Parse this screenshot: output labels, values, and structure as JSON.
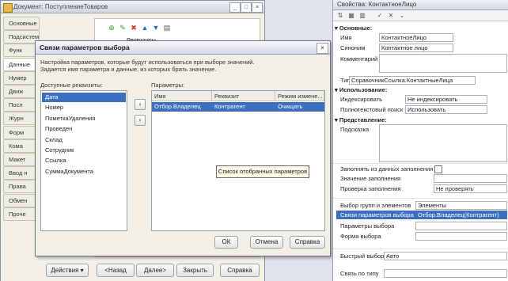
{
  "doc_window": {
    "title": "Документ: ПоступлениеТоваров",
    "tabs": [
      "Основные",
      "Подсистемы",
      "Функ",
      "Данные",
      "Нумер",
      "Движ",
      "Посл",
      "Журн",
      "Форм",
      "Кома",
      "Макет",
      "Ввод н",
      "Права",
      "Обмен",
      "Проче"
    ],
    "panel_item": "Реквизиты",
    "bottom_buttons": {
      "actions": "Действия",
      "back": "<Назад",
      "next": "Далее>",
      "close": "Закрыть",
      "help": "Справка"
    }
  },
  "dialog": {
    "title": "Связи параметров выбора",
    "description_line1": "Настройка параметров, которые будут использоваться при выборе значений.",
    "description_line2": "Задается имя параметра и данные, из которых брать значение.",
    "available_label": "Доступные реквизиты:",
    "params_label": "Параметры:",
    "available_items": [
      "Дата",
      "Номер",
      "ПометкаУдаления",
      "Проведен",
      "Склад",
      "Сотрудник",
      "Ссылка",
      "СуммаДокумента"
    ],
    "columns": {
      "name": "Имя",
      "attribute": "Реквизит",
      "mode": "Режим измене..."
    },
    "row": {
      "name": "Отбор.Владелец",
      "attribute": "Контрагент",
      "mode": "Очищать"
    },
    "tooltip": "Список отобранных параметров",
    "buttons": {
      "ok": "ОК",
      "cancel": "Отмена",
      "help": "Справка"
    }
  },
  "props": {
    "title": "Свойства: КонтактноеЛицо",
    "sections": {
      "main": "Основные:",
      "usage": "Использование:",
      "view": "Представление:"
    },
    "name_label": "Имя",
    "name_value": "КонтактноеЛицо",
    "synonym_label": "Синоним",
    "synonym_value": "Контактное лицо",
    "comment_label": "Комментарий",
    "type_label": "Тип",
    "type_value": "СправочникСсылка.КонтактныеЛица",
    "index_label": "Индексировать",
    "index_value": "Не индексировать",
    "fts_label": "Полнотекстовый поиск",
    "fts_value": "Использовать",
    "hint_label": "Подсказка",
    "fill_from_label": "Заполнять из данных заполнения",
    "fill_value_label": "Значение заполнения",
    "check_fill_label": "Проверка заполнения",
    "check_fill_value": "Не проверять",
    "group_select_label": "Выбор групп и элементов",
    "group_select_value": "Элементы",
    "links_label": "Связи параметров выбора",
    "links_value": "Отбор.Владелец(Контрагент)",
    "params_label": "Параметры выбора",
    "form_label": "Форма выбора",
    "quick_label": "Быстрый выбор",
    "quick_value": "Авто",
    "link_type_label": "Связь по типу"
  },
  "colors": {
    "selection": "#3c6fbf",
    "accent_green": "#3a9a2a",
    "accent_red": "#d0392b",
    "accent_blue": "#2f6fc9"
  },
  "icons": [
    "window-icon",
    "minimize-icon",
    "maximize-icon",
    "close-icon",
    "add-icon",
    "edit-icon",
    "delete-icon",
    "move-up-icon",
    "move-down-icon",
    "arrow-right-icon",
    "arrow-left-icon",
    "sort-icon",
    "check-icon",
    "cancel-icon",
    "chevron-down-icon"
  ]
}
